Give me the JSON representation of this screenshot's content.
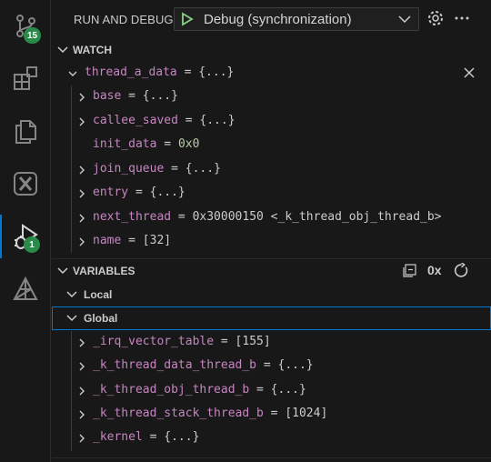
{
  "activity_bar": {
    "scm_badge": "15",
    "debug_badge": "1"
  },
  "topbar": {
    "title": "RUN AND DEBUG",
    "config_label": "Debug (synchronization)"
  },
  "watch": {
    "header": "WATCH",
    "root": {
      "name": "thread_a_data",
      "value": "{...}"
    },
    "children": [
      {
        "name": "base",
        "value": "{...}",
        "expandable": true
      },
      {
        "name": "callee_saved",
        "value": "{...}",
        "expandable": true
      },
      {
        "name": "init_data",
        "value": "0x0",
        "expandable": false
      },
      {
        "name": "join_queue",
        "value": "{...}",
        "expandable": true
      },
      {
        "name": "entry",
        "value": "{...}",
        "expandable": true
      },
      {
        "name": "next_thread",
        "value": "0x30000150 <_k_thread_obj_thread_b>",
        "expandable": true
      },
      {
        "name": "name",
        "value": "[32]",
        "expandable": true
      }
    ]
  },
  "variables": {
    "header": "VARIABLES",
    "format_label": "0x",
    "scopes": [
      {
        "label": "Local"
      },
      {
        "label": "Global"
      }
    ],
    "globals": [
      {
        "name": "_irq_vector_table",
        "value": "[155]"
      },
      {
        "name": "_k_thread_data_thread_b",
        "value": "{...}"
      },
      {
        "name": "_k_thread_obj_thread_b",
        "value": "{...}"
      },
      {
        "name": "_k_thread_stack_thread_b",
        "value": "[1024]"
      },
      {
        "name": "_kernel",
        "value": "{...}"
      }
    ]
  },
  "colors": {
    "accent": "#0078d4",
    "variable_name": "#c586c0",
    "number": "#b5cea8",
    "badge": "#2a8a4a",
    "play_green": "#89d185"
  },
  "icons": [
    "source-control-icon",
    "explorer-icon",
    "copy-icon",
    "x-extension-icon",
    "run-debug-icon",
    "triangle-tool-icon",
    "play-icon",
    "chevron-down-icon",
    "gear-icon",
    "more-icon",
    "close-icon",
    "collapse-all-icon",
    "refresh-icon"
  ]
}
